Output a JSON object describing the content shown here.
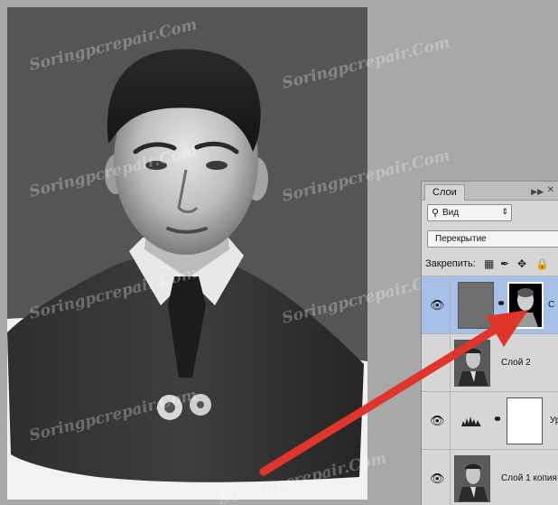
{
  "watermark": {
    "text": "Soringpcrepair.Com"
  },
  "layers_panel": {
    "tab_label": "Слои",
    "collapse_icon": "double-chevron-right",
    "close_icon": "close-x",
    "filter": {
      "icon": "search-icon",
      "label": "Вид",
      "arrow": "⇕"
    },
    "blend_mode": {
      "label": "Перекрытие"
    },
    "lock": {
      "label": "Закрепить:"
    },
    "layers": [
      {
        "name": "С",
        "selected": true,
        "has_mask": true,
        "kind": "gray-fill"
      },
      {
        "name": "Слой 2",
        "selected": false,
        "has_mask": false,
        "kind": "portrait"
      },
      {
        "name": "Ур",
        "selected": false,
        "has_mask": true,
        "kind": "levels"
      },
      {
        "name": "Слой 1 копия",
        "selected": false,
        "has_mask": false,
        "kind": "portrait"
      }
    ]
  },
  "colors": {
    "canvas_bg": "#a8a8a8",
    "photo_bg": "#555555",
    "selected_layer": "#a7c0e8",
    "arrow": "#e0352b"
  }
}
